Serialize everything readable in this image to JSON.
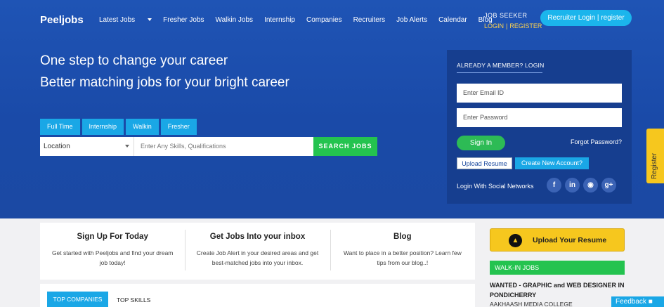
{
  "brand": {
    "logo": "Peeljobs"
  },
  "nav": {
    "items": [
      "Latest Jobs",
      "Fresher Jobs",
      "Walkin Jobs",
      "Internship",
      "Companies",
      "Recruiters",
      "Job Alerts",
      "Calendar",
      "Blog"
    ]
  },
  "job_seeker": {
    "title": "JOB SEEKER",
    "login": "LOGIN",
    "separator": "|",
    "register": "REGISTER"
  },
  "recruiter_button": "Recruiter Login | register",
  "hero": {
    "line1": "One step to change your career",
    "line2": "Better matching jobs for your bright career"
  },
  "job_types": [
    "Full Time",
    "Internship",
    "Walkin",
    "Fresher"
  ],
  "search": {
    "location": "Location",
    "skills_placeholder": "Enter Any Skills, Qualifications",
    "button": "SEARCH JOBS"
  },
  "login": {
    "title": "ALREADY A MEMBER? LOGIN",
    "email_placeholder": "Enter Email ID",
    "password_placeholder": "Enter Password",
    "sign_in": "Sign In",
    "forgot": "Forgot Password?",
    "upload_resume": "Upload Resume",
    "create_account": "Create New Account?",
    "social_label": "Login With Social Networks",
    "social": [
      "f",
      "in",
      "gh",
      "g+"
    ]
  },
  "side_tab": {
    "label": "Register"
  },
  "info": [
    {
      "title": "Sign Up For Today",
      "desc": "Get started with Peeljobs and find your dream job today!"
    },
    {
      "title": "Get Jobs Into your inbox",
      "desc": "Create Job Alert in your desired areas and get best-matched jobs into your inbox."
    },
    {
      "title": "Blog",
      "desc": "Want to place in a better position? Learn few tips from our blog..!"
    }
  ],
  "bottom_tabs": {
    "top_companies": "TOP COMPANIES",
    "top_skills": "TOP SKILLS"
  },
  "upload_resume_cta": "Upload Your Resume",
  "walkin": {
    "header": "WALK-IN JOBS",
    "title": "WANTED - GRAPHIC and WEB DESIGNER IN PONDICHERRY",
    "company": "AAKHAASH MEDIA COLLEGE"
  },
  "feedback": "Feedback",
  "colors": {
    "primary": "#1f54b5",
    "accent": "#1aa7e6",
    "green": "#24c34f",
    "yellow": "#f6c71e"
  }
}
